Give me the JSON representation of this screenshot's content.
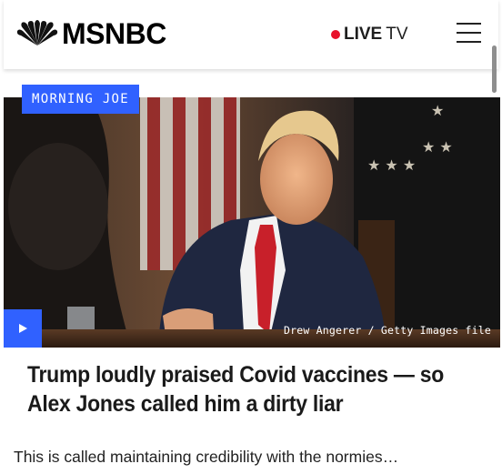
{
  "header": {
    "brand": "MSNBC",
    "live_label": "LIVE",
    "tv_label": "TV",
    "live_dot_color": "#e8122b",
    "menu_icon": "hamburger-menu-icon"
  },
  "article": {
    "section_tag": "MORNING JOE",
    "photo_credit": "Drew Angerer / Getty Images file",
    "headline": "Trump loudly praised Covid vaccines — so Alex Jones called him a dirty liar",
    "dek": "This is called maintaining credibility with the normies…",
    "play_icon": "play-icon",
    "accent_color": "#3061ff"
  }
}
